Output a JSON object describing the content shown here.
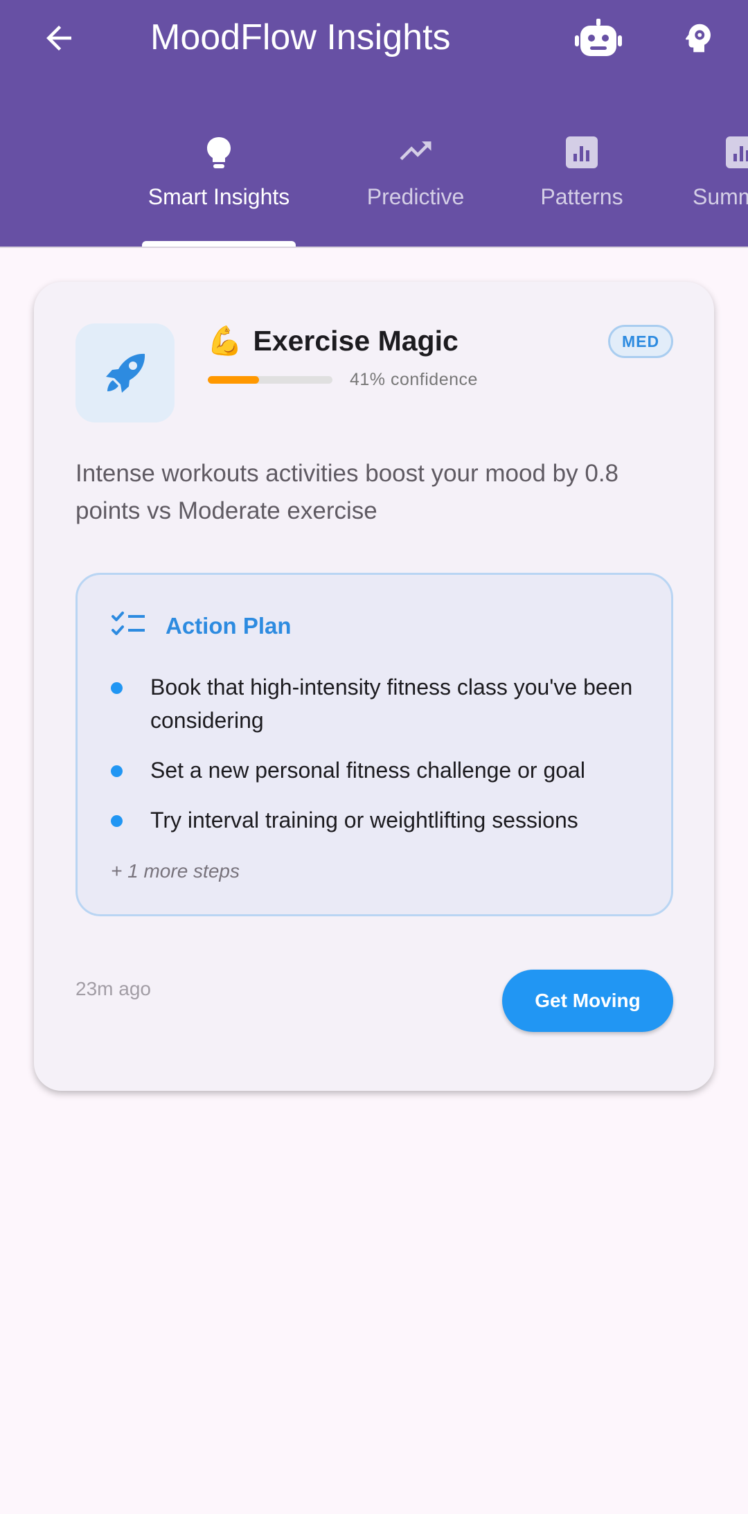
{
  "app_bar": {
    "title": "MoodFlow Insights",
    "back_icon": "arrow-back-icon",
    "actions": [
      "robot-icon",
      "psychology-icon"
    ],
    "color": "#6750a4"
  },
  "tabs": [
    {
      "label": "Smart Insights",
      "icon": "lightbulb-icon",
      "active": true
    },
    {
      "label": "Predictive",
      "icon": "trending-up-icon",
      "active": false
    },
    {
      "label": "Patterns",
      "icon": "bar-chart-icon",
      "active": false
    },
    {
      "label": "Summ",
      "icon": "bar-chart-icon",
      "active": false
    }
  ],
  "insight_card": {
    "emoji": "💪",
    "title": "Exercise Magic",
    "icon": "rocket-icon",
    "confidence": 0.41,
    "confidence_label": "41% confidence",
    "badge": "MED",
    "description": "Intense workouts activities boost your mood by 0.8 points vs Moderate exercise",
    "action_plan": {
      "title": "Action Plan",
      "icon": "checklist-icon",
      "items": [
        "Book that high-intensity fitness class you've been considering",
        "Set a new personal fitness challenge or goal",
        "Try interval training or weightlifting sessions"
      ],
      "more": "+ 1 more steps"
    },
    "timestamp": "23m ago",
    "cta_label": "Get Moving"
  },
  "colors": {
    "accent_blue": "#2196f3",
    "confidence_orange": "#ff9800",
    "primary_purple": "#6750a4"
  }
}
